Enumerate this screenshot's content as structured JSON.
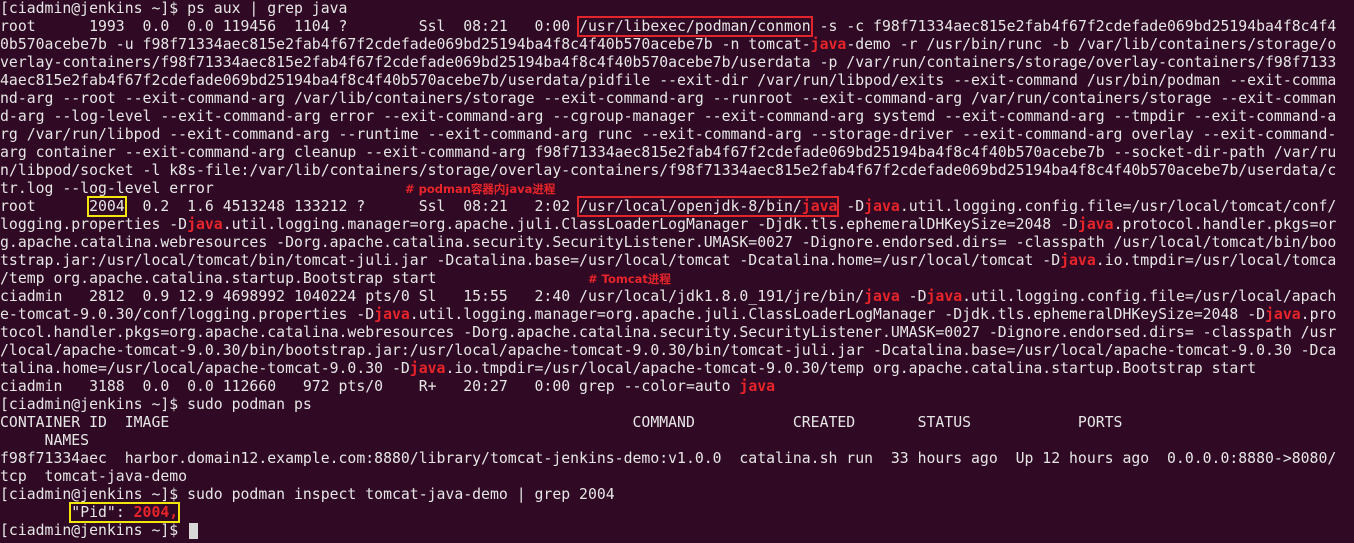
{
  "terminal": {
    "lines": [
      "[ciadmin@jenkins ~]$ ps aux | grep java",
      "root      1993  0.0  0.0 119456  1104 ?        Ssl  08:21   0:00 ",
      "0b570acebe7b -u f98f71334aec815e2fab4f67f2cdefade069bd25194ba4f8c4f40b570acebe7b -n tomcat-",
      "verlay-containers/f98f71334aec815e2fab4f67f2cdefade069bd25194ba4f8c4f40b570acebe7b/userdata -p /var/run/containers/storage/overlay-containers/f98f7133",
      "4aec815e2fab4f67f2cdefade069bd25194ba4f8c4f40b570acebe7b/userdata/pidfile --exit-dir /var/run/libpod/exits --exit-command /usr/bin/podman --exit-comma",
      "nd-arg --root --exit-command-arg /var/lib/containers/storage --exit-command-arg --runroot --exit-command-arg /var/run/containers/storage --exit-comman",
      "d-arg --log-level --exit-command-arg error --exit-command-arg --cgroup-manager --exit-command-arg systemd --exit-command-arg --tmpdir --exit-command-a",
      "rg /var/run/libpod --exit-command-arg --runtime --exit-command-arg runc --exit-command-arg --storage-driver --exit-command-arg overlay --exit-command-",
      "arg container --exit-command-arg cleanup --exit-command-arg f98f71334aec815e2fab4f67f2cdefade069bd25194ba4f8c4f40b570acebe7b --socket-dir-path /var/ru",
      "n/libpod/socket -l k8s-file:/var/lib/containers/storage/overlay-containers/f98f71334aec815e2fab4f67f2cdefade069bd25194ba4f8c4f40b570acebe7b/userdata/c",
      "tr.log --log-level error",
      "root      ",
      "logging.properties -D",
      "g.apache.catalina.webresources -Dorg.apache.catalina.security.SecurityListener.UMASK=0027 -Dignore.endorsed.dirs= -classpath /usr/local/tomcat/bin/boo",
      "tstrap.jar:/usr/local/tomcat/bin/tomcat-juli.jar -Dcatalina.base=/usr/local/tomcat -Dcatalina.home=/usr/local/tomcat -D",
      "/temp org.apache.catalina.startup.Bootstrap start",
      "ciadmin   2812  0.9 12.9 4698992 1040224 pts/0 Sl   15:55   2:40 /usr/local/jdk1.8.0_191/jre/bin/",
      "e-tomcat-9.0.30/conf/logging.properties -D",
      "tocol.handler.pkgs=org.apache.catalina.webresources -Dorg.apache.catalina.security.SecurityListener.UMASK=0027 -Dignore.endorsed.dirs= -classpath /usr",
      "/local/apache-tomcat-9.0.30/bin/bootstrap.jar:/usr/local/apache-tomcat-9.0.30/bin/tomcat-juli.jar -Dcatalina.base=/usr/local/apache-tomcat-9.0.30 -Dca",
      "talina.home=/usr/local/apache-tomcat-9.0.30 -D",
      "ciadmin   3188  0.0  0.0 112660   972 pts/0    R+   20:27   0:00 grep --color=auto ",
      "[ciadmin@jenkins ~]$ sudo podman ps",
      "CONTAINER ID  IMAGE                                                    COMMAND           CREATED       STATUS            PORTS",
      "     NAMES",
      "f98f71334aec  harbor.domain12.example.com:8880/library/tomcat-jenkins-demo:v1.0.0  catalina.sh run  33 hours ago  Up 12 hours ago  0.0.0.0:8880->8080/",
      "tcp  tomcat-java-demo",
      "[ciadmin@jenkins ~]$ sudo podman inspect tomcat-java-demo | grep 2004",
      "        ",
      "[ciadmin@jenkins ~]$ "
    ],
    "fragments": {
      "conmon_path": "/usr/libexec/podman/conmon",
      "line1_tail": " -s -c f98f71334aec815e2fab4f67f2cdefade069bd25194ba4f8c4f4",
      "java": "java",
      "line2_tail": "-demo -r /usr/bin/runc -b /var/lib/containers/storage/o",
      "pid_2004": "2004",
      "root_2004_mid": "  0.2  1.6 4513248 133212 ?      Ssl  08:21   2:02 ",
      "openjdk_prefix": "/usr/local/openjdk-8/bin/",
      "root_2004_tail1": " -D",
      "root_2004_tail2": ".util.logging.config.file=/usr/local/tomcat/conf/",
      "l12_tail1": ".util.logging.manager=org.apache.juli.ClassLoaderLogManager -Djdk.tls.ephemeralDHKeySize=2048 -D",
      "l12_tail2": ".protocol.handler.pkgs=or",
      "l14_tail": ".io.tmpdir=/usr/local/tomca",
      "l16_mid": " -D",
      "l16_tail": ".util.logging.config.file=/usr/local/apach",
      "l17_tail1": ".util.logging.manager=org.apache.juli.ClassLoaderLogManager -Djdk.tls.ephemeralDHKeySize=2048 -D",
      "l17_tail2": ".pro",
      "l20_tail": ".io.tmpdir=/usr/local/apache-tomcat-9.0.30/temp org.apache.catalina.startup.Bootstrap start",
      "pid_key": "\"Pid\": ",
      "pid_value": "2004,"
    },
    "notes": {
      "podman_java": "# podman容器内java进程",
      "tomcat": "# Tomcat进程"
    }
  },
  "colors": {
    "background": "#300a24",
    "text": "#e6e6e6",
    "match": "#e8242a",
    "box_red": "#e1252b",
    "box_yellow": "#f2e60a"
  }
}
